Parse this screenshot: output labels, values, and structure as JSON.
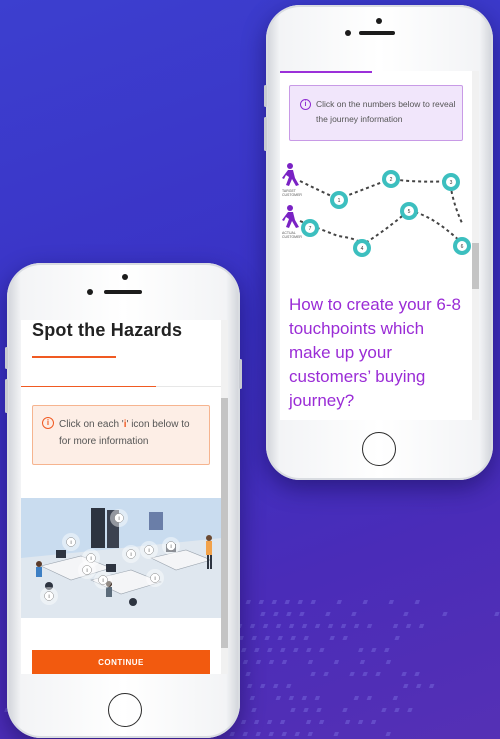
{
  "left_phone": {
    "title": "Spot the Hazards",
    "note_prefix": "Click on each '",
    "note_icon_char": "i",
    "note_suffix": "' icon below to for more information",
    "hotspot_label": "i",
    "continue_label": "CONTINUE",
    "accent_color": "#f05a22"
  },
  "right_phone": {
    "note_text": "Click on the numbers below to reveal the journey information",
    "journey": {
      "target_label_line1": "TARGET",
      "target_label_line2": "CUSTOMER",
      "actual_label_line1": "ACTUAL",
      "actual_label_line2": "CUSTOMER",
      "numbers": [
        "1",
        "2",
        "3",
        "4",
        "5",
        "6",
        "7"
      ]
    },
    "heading": "How to create your 6-8 touchpoints which make up your customers’ buying journey?",
    "accent_color": "#9a2cd6",
    "teal_color": "#3cbfbf"
  }
}
